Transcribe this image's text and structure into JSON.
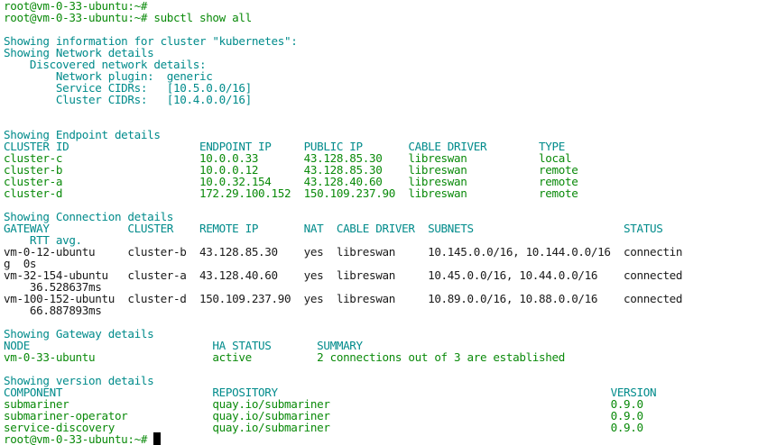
{
  "terminal": {
    "colors": {
      "background": "#ffffff",
      "text": "#1a1a1a",
      "prompt_green": "#0a8a0a",
      "cyan": "#008b8b"
    },
    "lines": [
      {
        "text": "root@vm-0-33-ubuntu:~#",
        "style": "green"
      },
      {
        "text": "root@vm-0-33-ubuntu:~# subctl show all",
        "style": "green"
      },
      {
        "text": "",
        "style": ""
      },
      {
        "text": "Showing information for cluster \"kubernetes\":",
        "style": "cyan"
      },
      {
        "text": "Showing Network details",
        "style": "cyan"
      },
      {
        "text": "    Discovered network details:",
        "style": "cyan"
      },
      {
        "text": "        Network plugin:  generic",
        "style": "cyan"
      },
      {
        "text": "        Service CIDRs:   [10.5.0.0/16]",
        "style": "cyan"
      },
      {
        "text": "        Cluster CIDRs:   [10.4.0.0/16]",
        "style": "cyan"
      },
      {
        "text": "",
        "style": ""
      },
      {
        "text": "",
        "style": ""
      },
      {
        "text": "Showing Endpoint details",
        "style": "cyan"
      },
      {
        "text": "CLUSTER ID                    ENDPOINT IP     PUBLIC IP       CABLE DRIVER        TYPE",
        "style": "cyan"
      },
      {
        "text": "cluster-c                     10.0.0.33       43.128.85.30    libreswan           local",
        "style": "green"
      },
      {
        "text": "cluster-b                     10.0.0.12       43.128.85.30    libreswan           remote",
        "style": "green"
      },
      {
        "text": "cluster-a                     10.0.32.154     43.128.40.60    libreswan           remote",
        "style": "green"
      },
      {
        "text": "cluster-d                     172.29.100.152  150.109.237.90  libreswan           remote",
        "style": "green"
      },
      {
        "text": "",
        "style": ""
      },
      {
        "text": "Showing Connection details",
        "style": "cyan"
      },
      {
        "text": "GATEWAY            CLUSTER    REMOTE IP       NAT  CABLE DRIVER  SUBNETS                       STATUS",
        "style": "cyan"
      },
      {
        "text": "    RTT avg.",
        "style": "cyan"
      },
      {
        "text": "vm-0-12-ubuntu     cluster-b  43.128.85.30    yes  libreswan     10.145.0.0/16, 10.144.0.0/16  connectin",
        "style": ""
      },
      {
        "text": "g  0s",
        "style": ""
      },
      {
        "text": "vm-32-154-ubuntu   cluster-a  43.128.40.60    yes  libreswan     10.45.0.0/16, 10.44.0.0/16    connected",
        "style": ""
      },
      {
        "text": "    36.528637ms",
        "style": ""
      },
      {
        "text": "vm-100-152-ubuntu  cluster-d  150.109.237.90  yes  libreswan     10.89.0.0/16, 10.88.0.0/16    connected",
        "style": ""
      },
      {
        "text": "    66.887893ms",
        "style": ""
      },
      {
        "text": "",
        "style": ""
      },
      {
        "text": "Showing Gateway details",
        "style": "cyan"
      },
      {
        "text": "NODE                            HA STATUS       SUMMARY",
        "style": "cyan"
      },
      {
        "text": "vm-0-33-ubuntu                  active          2 connections out of 3 are established",
        "style": "green"
      },
      {
        "text": "",
        "style": ""
      },
      {
        "text": "Showing version details",
        "style": "cyan"
      },
      {
        "text": "COMPONENT                       REPOSITORY                                                   VERSION",
        "style": "cyan"
      },
      {
        "text": "submariner                      quay.io/submariner                                           0.9.0",
        "style": "green"
      },
      {
        "text": "submariner-operator             quay.io/submariner                                           0.9.0",
        "style": "green"
      },
      {
        "text": "service-discovery               quay.io/submariner                                           0.9.0",
        "style": "green"
      },
      {
        "text": "root@vm-0-33-ubuntu:~# ",
        "style": "green",
        "cursor": true
      }
    ]
  }
}
